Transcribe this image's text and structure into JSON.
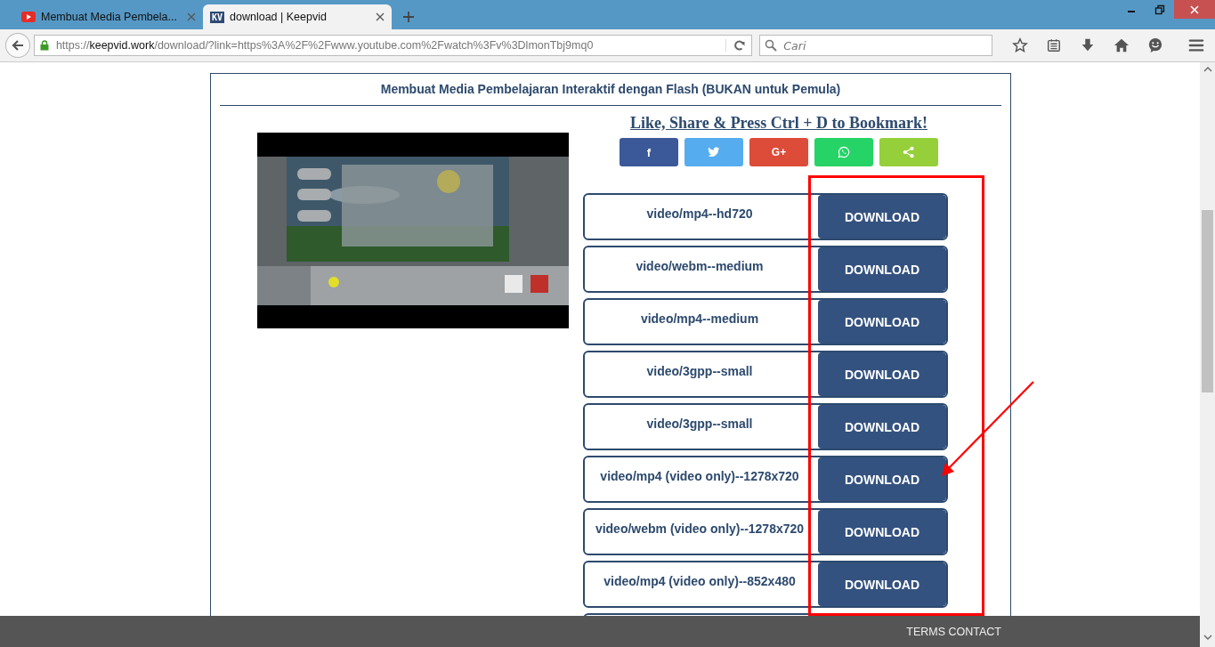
{
  "browser": {
    "tabs": [
      {
        "title": "Membuat Media Pembela...",
        "kind": "youtube",
        "selected": false
      },
      {
        "title": "download | Keepvid",
        "kind": "kv",
        "icon_text": "KV",
        "selected": true
      }
    ],
    "address": {
      "scheme": "https://",
      "domain": "keepvid.work",
      "path": "/download/?link=https%3A%2F%2Fwww.youtube.com%2Fwatch%3Fv%3DlmonTbj9mq0"
    },
    "search": {
      "placeholder": "Cari"
    }
  },
  "page": {
    "title": "Membuat Media Pembelajaran Interaktif dengan Flash (BUKAN untuk Pemula)",
    "share_heading": "Like, Share & Press Ctrl + D to Bookmark!",
    "share_buttons": [
      {
        "kind": "facebook",
        "label": "f",
        "color": "#3b5998"
      },
      {
        "kind": "twitter",
        "color": "#55acee"
      },
      {
        "kind": "googleplus",
        "label": "G+",
        "color": "#dd4b39"
      },
      {
        "kind": "whatsapp",
        "color": "#25d366"
      },
      {
        "kind": "share",
        "color": "#95d03a"
      }
    ],
    "formats": [
      {
        "name": "video/mp4--hd720",
        "button": "DOWNLOAD"
      },
      {
        "name": "video/webm--medium",
        "button": "DOWNLOAD"
      },
      {
        "name": "video/mp4--medium",
        "button": "DOWNLOAD"
      },
      {
        "name": "video/3gpp--small",
        "button": "DOWNLOAD"
      },
      {
        "name": "video/3gpp--small",
        "button": "DOWNLOAD"
      },
      {
        "name": "video/mp4 (video only)--1278x720",
        "button": "DOWNLOAD"
      },
      {
        "name": "video/webm (video only)--1278x720",
        "button": "DOWNLOAD"
      },
      {
        "name": "video/mp4 (video only)--852x480",
        "button": "DOWNLOAD"
      }
    ]
  },
  "footer": {
    "links": "TERMS CONTACT"
  }
}
